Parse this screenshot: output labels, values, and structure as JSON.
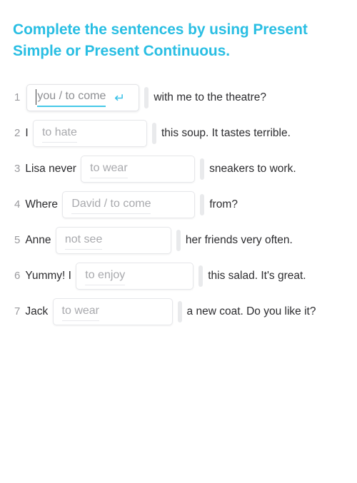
{
  "title": "Complete the sentences by using Present Simple or Present Continuous.",
  "colors": {
    "title": "#29bee3",
    "accent": "#45c8e8",
    "body_text": "#2c2c2f",
    "number": "#9a9a9e",
    "placeholder": "#a8a9ad",
    "field_border": "#e6e7ea",
    "slot_bar": "#e9eaec",
    "background": "#ffffff"
  },
  "icons": {
    "enter_key": "enter-return-arrow-icon"
  },
  "questions": [
    {
      "number": "1",
      "text_before": "",
      "answer_value": "you / to come",
      "placeholder": "you / to come",
      "field_width": 158,
      "focused": true,
      "has_enter_icon": true,
      "text_after": "with me to the theatre?"
    },
    {
      "number": "2",
      "text_before": "I",
      "answer_value": "to hate",
      "placeholder": "to hate",
      "field_width": 160,
      "focused": false,
      "has_enter_icon": false,
      "text_after": "this soup. It tastes terrible."
    },
    {
      "number": "3",
      "text_before": "Lisa never",
      "answer_value": "to wear",
      "placeholder": "to wear",
      "field_width": 160,
      "focused": false,
      "has_enter_icon": false,
      "text_after": "sneakers to work."
    },
    {
      "number": "4",
      "text_before": "Where",
      "answer_value": "David / to come",
      "placeholder": "David / to come",
      "field_width": 186,
      "focused": false,
      "has_enter_icon": false,
      "text_after": "from?"
    },
    {
      "number": "5",
      "text_before": "Anne",
      "answer_value": "not see",
      "placeholder": "not see",
      "field_width": 162,
      "focused": false,
      "has_enter_icon": false,
      "text_after": "her friends very often."
    },
    {
      "number": "6",
      "text_before": "Yummy! I",
      "answer_value": "to enjoy",
      "placeholder": "to enjoy",
      "field_width": 165,
      "focused": false,
      "has_enter_icon": false,
      "text_after": "this salad. It's great."
    },
    {
      "number": "7",
      "text_before": "Jack",
      "answer_value": "to wear",
      "placeholder": "to wear",
      "field_width": 168,
      "focused": false,
      "has_enter_icon": false,
      "text_after": "a new coat. Do you like it?"
    }
  ]
}
